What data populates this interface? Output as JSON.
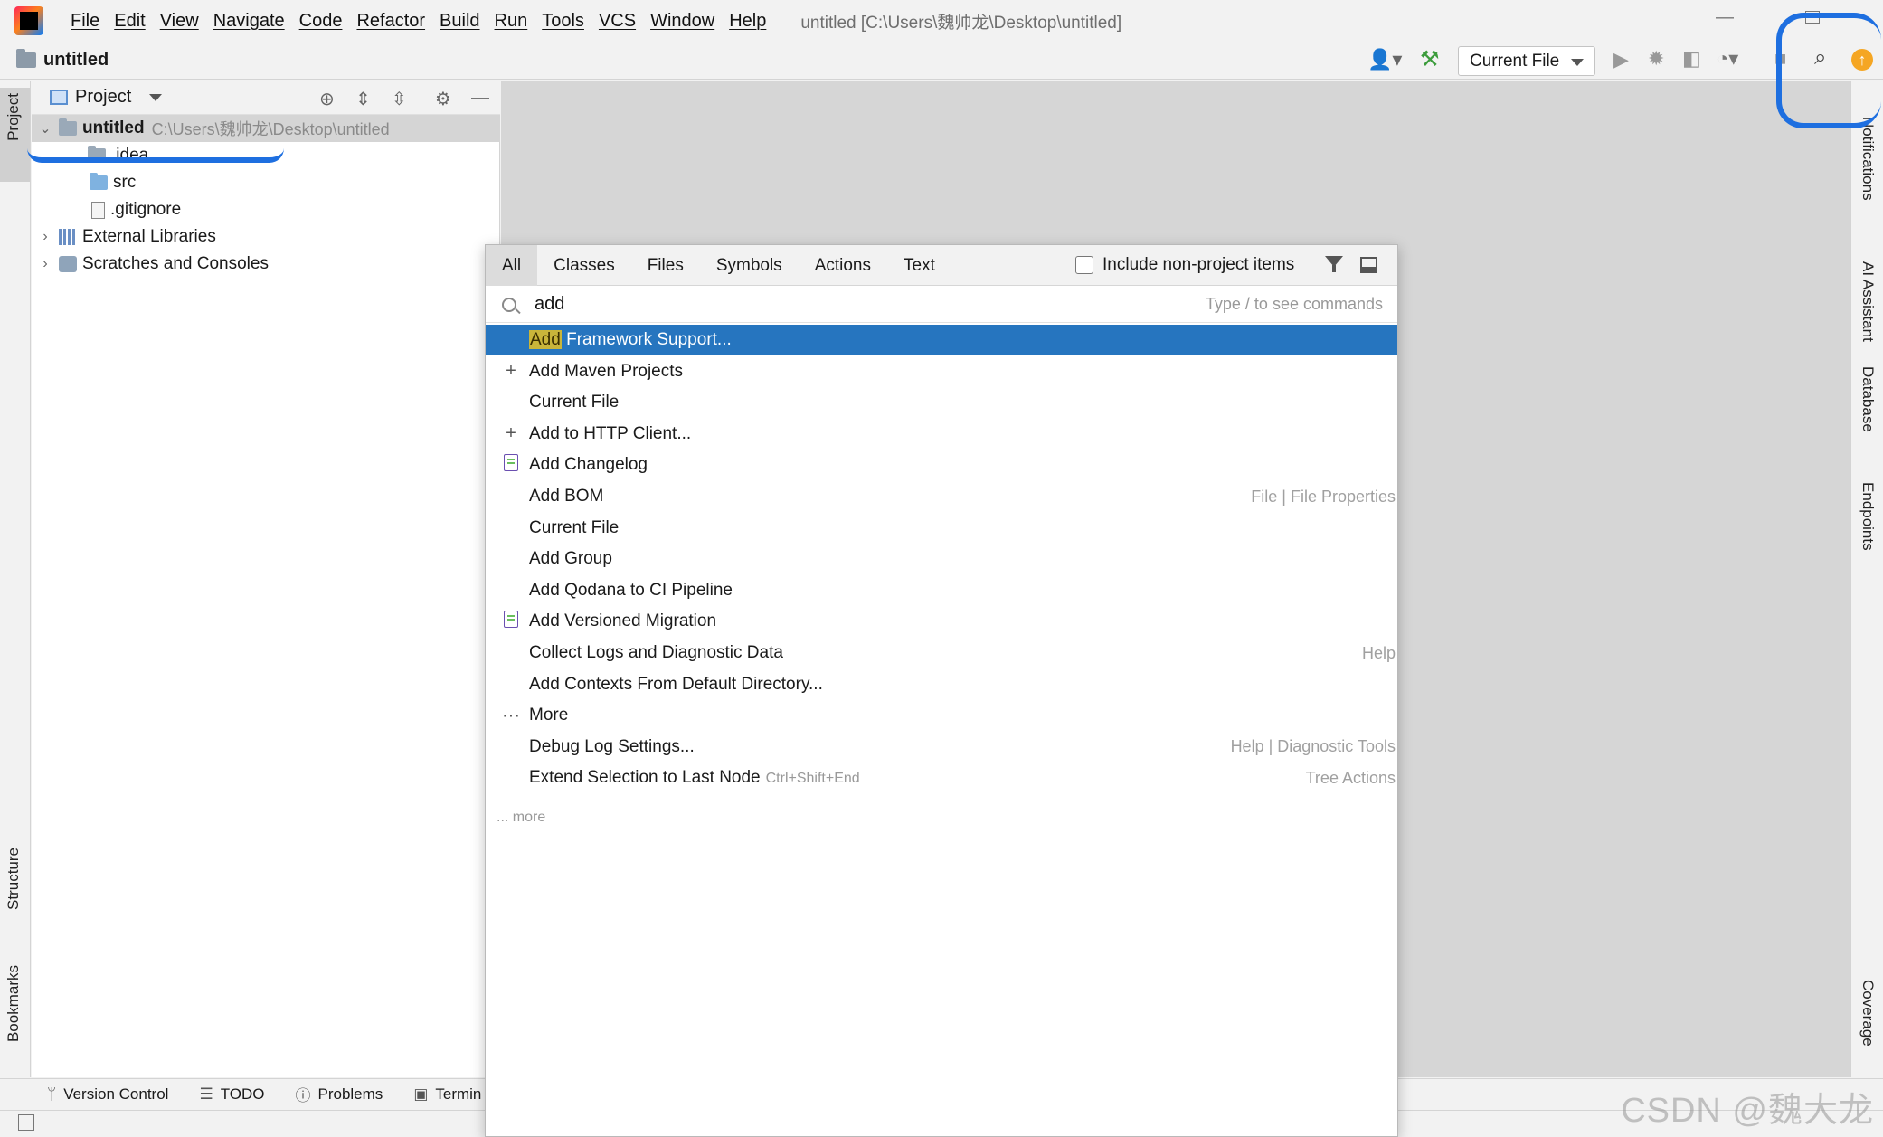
{
  "menubar": {
    "items": [
      "File",
      "Edit",
      "View",
      "Navigate",
      "Code",
      "Refactor",
      "Build",
      "Run",
      "Tools",
      "VCS",
      "Window",
      "Help"
    ],
    "window_title": "untitled [C:\\Users\\魏帅龙\\Desktop\\untitled]"
  },
  "navbar": {
    "breadcrumb": "untitled",
    "run_config": "Current File"
  },
  "left_strip": {
    "project_tab": "Project",
    "structure_tab": "Structure",
    "bookmarks_tab": "Bookmarks"
  },
  "project_panel": {
    "title": "Project",
    "tree": {
      "root_name": "untitled",
      "root_path": "C:\\Users\\魏帅龙\\Desktop\\untitled",
      "idea": ".idea",
      "src": "src",
      "gitignore": ".gitignore",
      "external_libraries": "External Libraries",
      "scratches": "Scratches and Consoles"
    }
  },
  "right_strip": {
    "notifications": "Notifications",
    "ai_assistant": "AI Assistant",
    "database": "Database",
    "endpoints": "Endpoints",
    "coverage": "Coverage"
  },
  "bottom_tools": {
    "version_control": "Version Control",
    "todo": "TODO",
    "problems": "Problems",
    "terminal": "Termin"
  },
  "search_popup": {
    "tabs": [
      "All",
      "Classes",
      "Files",
      "Symbols",
      "Actions",
      "Text"
    ],
    "include_non_project": "Include non-project items",
    "query": "add",
    "hint": "Type / to see commands",
    "results": [
      {
        "icon": "",
        "match": "Add",
        "rest": " Framework Support...",
        "location": "",
        "shortcut": ""
      },
      {
        "icon": "plus-icon",
        "match": "",
        "rest": "Add Maven Projects",
        "location": "",
        "shortcut": ""
      },
      {
        "icon": "",
        "match": "",
        "rest": "Current File",
        "location": "",
        "shortcut": ""
      },
      {
        "icon": "plus-icon",
        "match": "",
        "rest": "Add to HTTP Client...",
        "location": "",
        "shortcut": ""
      },
      {
        "icon": "changelog-icon",
        "match": "",
        "rest": "Add Changelog",
        "location": "",
        "shortcut": ""
      },
      {
        "icon": "",
        "match": "",
        "rest": "Add BOM",
        "location": "File | File Properties",
        "shortcut": ""
      },
      {
        "icon": "",
        "match": "",
        "rest": "Current File",
        "location": "",
        "shortcut": ""
      },
      {
        "icon": "",
        "match": "",
        "rest": "Add Group",
        "location": "",
        "shortcut": ""
      },
      {
        "icon": "",
        "match": "",
        "rest": "Add Qodana to CI Pipeline",
        "location": "",
        "shortcut": ""
      },
      {
        "icon": "changelog-icon",
        "match": "",
        "rest": "Add Versioned Migration",
        "location": "",
        "shortcut": ""
      },
      {
        "icon": "",
        "match": "",
        "rest": "Collect Logs and Diagnostic Data",
        "location": "Help",
        "shortcut": ""
      },
      {
        "icon": "",
        "match": "",
        "rest": "Add Contexts From Default Directory...",
        "location": "",
        "shortcut": ""
      },
      {
        "icon": "more-icon",
        "match": "",
        "rest": "More",
        "location": "",
        "shortcut": ""
      },
      {
        "icon": "",
        "match": "",
        "rest": "Debug Log Settings...",
        "location": "Help | Diagnostic Tools",
        "shortcut": ""
      },
      {
        "icon": "",
        "match": "",
        "rest": "Extend Selection to Last Node",
        "location": "Tree Actions",
        "shortcut": "Ctrl+Shift+End"
      }
    ],
    "more_link": "... more"
  },
  "watermark": "CSDN @魏大龙"
}
